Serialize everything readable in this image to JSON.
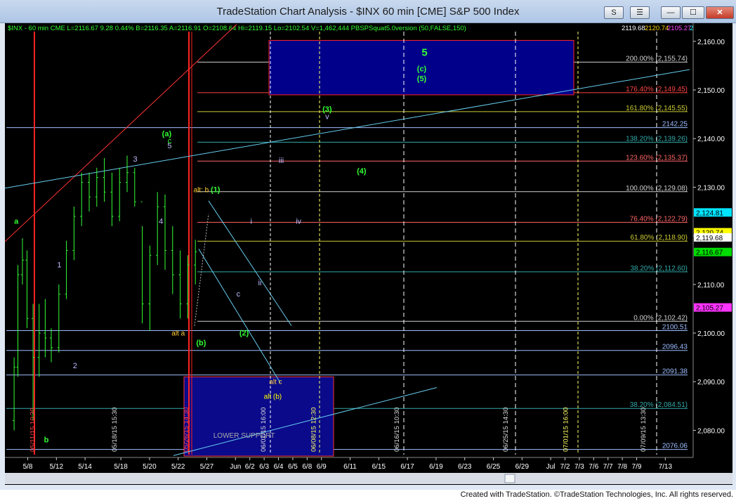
{
  "window": {
    "title": "TradeStation Chart Analysis - $INX 60 min [CME] S&P 500 Index",
    "btn_s": "S",
    "btn_menu": "☰",
    "btn_min": "—",
    "btn_max": "☐",
    "btn_close": "✕"
  },
  "status_bar": {
    "text": "$INX - 60 min  CME  L=2116.67  9.28    0.44%   B=2116.35  A=2116.91  O=2108.64  Hi=2119.15  Lo=2102.54  V=1,462,444  PBSPSquat5.0version (50,FALSE,150)",
    "readouts": [
      "2119.68",
      "2120.74",
      "2105.27",
      "2124.81"
    ],
    "readout_colors": [
      "#ffffff",
      "#ffd700",
      "#ff44ff",
      "#00ffff"
    ]
  },
  "footer": {
    "text": "Created with TradeStation. ©TradeStation Technologies, Inc. All rights reserved."
  },
  "chart_data": {
    "type": "candlestick",
    "symbol": "$INX",
    "interval": "60 min",
    "ylim": [
      2075,
      2162
    ],
    "y_ticks": [
      2080,
      2090,
      2100,
      2110,
      2120,
      2130,
      2140,
      2150,
      2160
    ],
    "y_tick_labels": [
      "2,080.00",
      "2,090.00",
      "2,100.00",
      "2,110.00",
      "2,120.00",
      "2,130.00",
      "2,140.00",
      "2,150.00",
      "2,160.00"
    ],
    "x_ticks": [
      {
        "label": "5/8",
        "i": 2
      },
      {
        "label": "5/12",
        "i": 6
      },
      {
        "label": "5/14",
        "i": 10
      },
      {
        "label": "5/18",
        "i": 15
      },
      {
        "label": "5/20",
        "i": 19
      },
      {
        "label": "5/22",
        "i": 23
      },
      {
        "label": "5/27",
        "i": 27
      },
      {
        "label": "Jun",
        "i": 31
      },
      {
        "label": "6/2",
        "i": 33
      },
      {
        "label": "6/3",
        "i": 35
      },
      {
        "label": "6/4",
        "i": 37
      },
      {
        "label": "6/5",
        "i": 39
      },
      {
        "label": "6/8",
        "i": 41
      },
      {
        "label": "6/9",
        "i": 43
      },
      {
        "label": "6/11",
        "i": 47
      },
      {
        "label": "6/15",
        "i": 51
      },
      {
        "label": "6/17",
        "i": 55
      },
      {
        "label": "6/19",
        "i": 59
      },
      {
        "label": "6/23",
        "i": 63
      },
      {
        "label": "6/25",
        "i": 67
      },
      {
        "label": "6/29",
        "i": 71
      },
      {
        "label": "Jul",
        "i": 75
      },
      {
        "label": "7/2",
        "i": 77
      },
      {
        "label": "7/3",
        "i": 79
      },
      {
        "label": "7/6",
        "i": 81
      },
      {
        "label": "7/7",
        "i": 83
      },
      {
        "label": "7/8",
        "i": 85
      },
      {
        "label": "7/9",
        "i": 87
      },
      {
        "label": "7/13",
        "i": 91
      }
    ],
    "bars": [
      [
        2082.0,
        2095.0,
        2080.0,
        2093.0
      ],
      [
        2093.0,
        2114.0,
        2091.0,
        2112.0
      ],
      [
        2112.0,
        2119.5,
        2110.0,
        2115.0
      ],
      [
        2115.0,
        2117.0,
        2101.0,
        2103.0
      ],
      [
        2103.0,
        2106.0,
        2082.0,
        2095.0
      ],
      [
        2095.0,
        2106.0,
        2091.0,
        2100.0
      ],
      [
        2100.0,
        2107.0,
        2095.0,
        2099.0
      ],
      [
        2099.0,
        2101.0,
        2094.0,
        2097.0
      ],
      [
        2097.0,
        2110.0,
        2096.0,
        2108.0
      ],
      [
        2108.0,
        2119.0,
        2107.0,
        2117.0
      ],
      [
        2117.0,
        2126.0,
        2115.0,
        2124.0
      ],
      [
        2124.0,
        2133.0,
        2122.0,
        2131.0
      ],
      [
        2131.0,
        2133.0,
        2125.0,
        2128.0
      ],
      [
        2128.0,
        2134.0,
        2126.0,
        2132.0
      ],
      [
        2132.0,
        2136.0,
        2127.0,
        2129.0
      ],
      [
        2129.0,
        2133.0,
        2122.0,
        2124.0
      ],
      [
        2124.0,
        2134.0,
        2123.0,
        2131.0
      ],
      [
        2131.0,
        2136.5,
        2129.0,
        2133.0
      ],
      [
        2133.0,
        2134.0,
        2126.0,
        2127.0
      ],
      [
        2127.0,
        2122.0,
        2102.0,
        2106.0
      ],
      [
        2106.0,
        2118.0,
        2100.5,
        2116.0
      ],
      [
        2116.0,
        2129.0,
        2114.0,
        2126.0
      ],
      [
        2126.0,
        2128.5,
        2113.0,
        2117.0
      ],
      [
        2117.0,
        2122.0,
        2108.0,
        2112.0
      ],
      [
        2112.0,
        2117.0,
        2103.0,
        2106.0
      ],
      [
        2106.0,
        2116.0,
        2103.0,
        2114.0
      ],
      [
        2114.0,
        2119.2,
        2110.0,
        2116.7
      ]
    ],
    "bar_positions": [
      0.1,
      0.6,
      1.2,
      1.8,
      2.6,
      3.4,
      4.2,
      5.0,
      6.0,
      7.0,
      8.0,
      9.0,
      10.0,
      11.0,
      12.0,
      13.0,
      14.0,
      15.0,
      16.0,
      17.0,
      18.0,
      19.0,
      20.0,
      21.0,
      22.0,
      23.0,
      24.0
    ],
    "bar_dates": [
      "5/8",
      "5/8",
      "5/8",
      "5/11",
      "5/12",
      "5/12",
      "5/13",
      "5/14",
      "5/15",
      "5/18",
      "5/18",
      "5/19",
      "5/20",
      "5/20",
      "5/21",
      "5/22",
      "5/22",
      "5/26",
      "5/26",
      "5/27",
      "5/27",
      "5/28",
      "5/29",
      "5/29",
      "6/1",
      "6/1",
      "6/2"
    ],
    "h_lines": [
      {
        "label": "200.00% (2,155.74)",
        "value": 2155.74,
        "color": "#d0d0d0"
      },
      {
        "label": "176.40% (2,149.45)",
        "value": 2149.45,
        "color": "#ff4444"
      },
      {
        "label": "161.80% (2,145.55)",
        "value": 2145.55,
        "color": "#cccc33"
      },
      {
        "label": "2142.25",
        "value": 2142.25,
        "color": "#9bbdff"
      },
      {
        "label": "138.20% (2,139.26)",
        "value": 2139.26,
        "color": "#33aaaa"
      },
      {
        "label": "123.60% (2,135.37)",
        "value": 2135.37,
        "color": "#ff6666"
      },
      {
        "label": "100.00% (2,129.08)",
        "value": 2129.08,
        "color": "#d0d0d0"
      },
      {
        "label": "76.40% (2,122.79)",
        "value": 2122.79,
        "color": "#ff6666"
      },
      {
        "label": "61.80% (2,118.90)",
        "value": 2118.9,
        "color": "#cccc33"
      },
      {
        "label": "38.20% (2,112.60)",
        "value": 2112.6,
        "color": "#33aaaa"
      },
      {
        "label": "0.00% (2,102.42)",
        "value": 2102.42,
        "color": "#d0d0d0"
      },
      {
        "label": "2100.51",
        "value": 2100.51,
        "color": "#9bbdff"
      },
      {
        "label": "2096.43",
        "value": 2096.43,
        "color": "#9bbdff"
      },
      {
        "label": "2091.38",
        "value": 2091.38,
        "color": "#9bbdff"
      },
      {
        "label": "38.20% (2,084.51)",
        "value": 2084.51,
        "color": "#33aaaa"
      },
      {
        "label": "2076.06",
        "value": 2076.06,
        "color": "#9bbdff"
      }
    ],
    "right_badges": [
      {
        "label": "2,124.81",
        "value": 2124.81,
        "bg": "#00e5ff",
        "fg": "#000000"
      },
      {
        "label": "2,120.74",
        "value": 2120.74,
        "bg": "#ffff00",
        "fg": "#000000"
      },
      {
        "label": "2,119.68",
        "value": 2119.68,
        "bg": "#ffffff",
        "fg": "#000000"
      },
      {
        "label": "2,116.67",
        "value": 2116.67,
        "bg": "#00dd00",
        "fg": "#000000"
      },
      {
        "label": "2,105.27",
        "value": 2105.27,
        "bg": "#ff33ff",
        "fg": "#000000"
      }
    ],
    "wave_labels": [
      {
        "t": "a",
        "x": 0.5,
        "y": 2122.5,
        "color": "#33ff33"
      },
      {
        "t": "b",
        "x": 2.6,
        "y": 2077.5,
        "color": "#33ff33"
      },
      {
        "t": "1",
        "x": 3.5,
        "y": 2113.5,
        "color": "#bbbbff"
      },
      {
        "t": "2",
        "x": 4.6,
        "y": 2092.8,
        "color": "#bbbbff"
      },
      {
        "t": "3",
        "x": 8.8,
        "y": 2135.3,
        "color": "#bbbbff"
      },
      {
        "t": "4",
        "x": 10.6,
        "y": 2122.5,
        "color": "#bbbbff"
      },
      {
        "t": "5",
        "x": 11.2,
        "y": 2138.0,
        "color": "#bbbbff"
      },
      {
        "t": "c",
        "x": 11.2,
        "y": 2139.0,
        "color": "#33ff33"
      },
      {
        "t": "(a)",
        "x": 11.0,
        "y": 2140.5,
        "color": "#33ff33"
      },
      {
        "t": "alt: b",
        "x": 13.4,
        "y": 2129.0,
        "color": "#ffcc33"
      },
      {
        "t": "(1)",
        "x": 14.4,
        "y": 2129.0,
        "color": "#33ff33"
      },
      {
        "t": "alt a",
        "x": 11.8,
        "y": 2099.5,
        "color": "#ffcc33"
      },
      {
        "t": "(b)",
        "x": 13.4,
        "y": 2097.5,
        "color": "#33ff33"
      },
      {
        "t": "c",
        "x": 16.0,
        "y": 2107.5,
        "color": "#bbbbff"
      },
      {
        "t": "(2)",
        "x": 16.4,
        "y": 2099.5,
        "color": "#33ff33"
      },
      {
        "t": "i",
        "x": 16.9,
        "y": 2122.5,
        "color": "#bbbbff"
      },
      {
        "t": "ii",
        "x": 17.5,
        "y": 2109.8,
        "color": "#bbbbff"
      },
      {
        "t": "iii",
        "x": 19.0,
        "y": 2135.0,
        "color": "#bbbbff"
      },
      {
        "t": "iv",
        "x": 20.2,
        "y": 2122.5,
        "color": "#bbbbff"
      },
      {
        "t": "v",
        "x": 22.2,
        "y": 2144.0,
        "color": "#bbbbff"
      },
      {
        "t": "(3)",
        "x": 22.2,
        "y": 2145.5,
        "color": "#33ff33"
      },
      {
        "t": "(4)",
        "x": 24.6,
        "y": 2132.8,
        "color": "#33ff33"
      },
      {
        "t": "5",
        "x": 29.0,
        "y": 2157.0,
        "color": "#33ff33"
      },
      {
        "t": "(c)",
        "x": 28.8,
        "y": 2153.8,
        "color": "#33ff33"
      },
      {
        "t": "(5)",
        "x": 28.8,
        "y": 2151.8,
        "color": "#33ff33"
      },
      {
        "t": "alt c",
        "x": 18.6,
        "y": 2089.5,
        "color": "#ffcc33"
      },
      {
        "t": "alt (b)",
        "x": 18.4,
        "y": 2086.5,
        "color": "#ffff00"
      },
      {
        "t": "LOWER SUPPORT",
        "x": 16.4,
        "y": 2078.5,
        "color": "#aaaaaa"
      }
    ],
    "vertical_date_labels": [
      {
        "t": "05/11/15 10:30",
        "x": 1.8,
        "color": "#ff4444"
      },
      {
        "t": "05/18/15 15:30",
        "x": 7.5,
        "color": "#dddddd"
      },
      {
        "t": "05/26/15 14:30",
        "x": 12.5,
        "color": "#ff4444"
      },
      {
        "t": "06/02/15 16:00",
        "x": 17.9,
        "color": "#dddddd"
      },
      {
        "t": "06/08/15 12:30",
        "x": 21.4,
        "color": "#ffff66"
      },
      {
        "t": "06/16/15 10:30",
        "x": 27.2,
        "color": "#dddddd"
      },
      {
        "t": "06/25/15 14:30",
        "x": 34.8,
        "color": "#dddddd"
      },
      {
        "t": "07/01/15 16:00",
        "x": 39.0,
        "color": "#ffff66"
      },
      {
        "t": "07/09/15 13:30",
        "x": 44.4,
        "color": "#dddddd"
      }
    ]
  }
}
